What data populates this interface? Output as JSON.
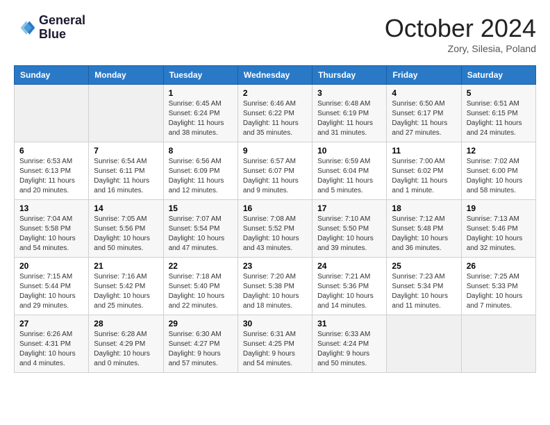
{
  "header": {
    "logo_line1": "General",
    "logo_line2": "Blue",
    "month": "October 2024",
    "location": "Zory, Silesia, Poland"
  },
  "weekdays": [
    "Sunday",
    "Monday",
    "Tuesday",
    "Wednesday",
    "Thursday",
    "Friday",
    "Saturday"
  ],
  "weeks": [
    [
      {
        "day": "",
        "sunrise": "",
        "sunset": "",
        "daylight": ""
      },
      {
        "day": "",
        "sunrise": "",
        "sunset": "",
        "daylight": ""
      },
      {
        "day": "1",
        "sunrise": "Sunrise: 6:45 AM",
        "sunset": "Sunset: 6:24 PM",
        "daylight": "Daylight: 11 hours and 38 minutes."
      },
      {
        "day": "2",
        "sunrise": "Sunrise: 6:46 AM",
        "sunset": "Sunset: 6:22 PM",
        "daylight": "Daylight: 11 hours and 35 minutes."
      },
      {
        "day": "3",
        "sunrise": "Sunrise: 6:48 AM",
        "sunset": "Sunset: 6:19 PM",
        "daylight": "Daylight: 11 hours and 31 minutes."
      },
      {
        "day": "4",
        "sunrise": "Sunrise: 6:50 AM",
        "sunset": "Sunset: 6:17 PM",
        "daylight": "Daylight: 11 hours and 27 minutes."
      },
      {
        "day": "5",
        "sunrise": "Sunrise: 6:51 AM",
        "sunset": "Sunset: 6:15 PM",
        "daylight": "Daylight: 11 hours and 24 minutes."
      }
    ],
    [
      {
        "day": "6",
        "sunrise": "Sunrise: 6:53 AM",
        "sunset": "Sunset: 6:13 PM",
        "daylight": "Daylight: 11 hours and 20 minutes."
      },
      {
        "day": "7",
        "sunrise": "Sunrise: 6:54 AM",
        "sunset": "Sunset: 6:11 PM",
        "daylight": "Daylight: 11 hours and 16 minutes."
      },
      {
        "day": "8",
        "sunrise": "Sunrise: 6:56 AM",
        "sunset": "Sunset: 6:09 PM",
        "daylight": "Daylight: 11 hours and 12 minutes."
      },
      {
        "day": "9",
        "sunrise": "Sunrise: 6:57 AM",
        "sunset": "Sunset: 6:07 PM",
        "daylight": "Daylight: 11 hours and 9 minutes."
      },
      {
        "day": "10",
        "sunrise": "Sunrise: 6:59 AM",
        "sunset": "Sunset: 6:04 PM",
        "daylight": "Daylight: 11 hours and 5 minutes."
      },
      {
        "day": "11",
        "sunrise": "Sunrise: 7:00 AM",
        "sunset": "Sunset: 6:02 PM",
        "daylight": "Daylight: 11 hours and 1 minute."
      },
      {
        "day": "12",
        "sunrise": "Sunrise: 7:02 AM",
        "sunset": "Sunset: 6:00 PM",
        "daylight": "Daylight: 10 hours and 58 minutes."
      }
    ],
    [
      {
        "day": "13",
        "sunrise": "Sunrise: 7:04 AM",
        "sunset": "Sunset: 5:58 PM",
        "daylight": "Daylight: 10 hours and 54 minutes."
      },
      {
        "day": "14",
        "sunrise": "Sunrise: 7:05 AM",
        "sunset": "Sunset: 5:56 PM",
        "daylight": "Daylight: 10 hours and 50 minutes."
      },
      {
        "day": "15",
        "sunrise": "Sunrise: 7:07 AM",
        "sunset": "Sunset: 5:54 PM",
        "daylight": "Daylight: 10 hours and 47 minutes."
      },
      {
        "day": "16",
        "sunrise": "Sunrise: 7:08 AM",
        "sunset": "Sunset: 5:52 PM",
        "daylight": "Daylight: 10 hours and 43 minutes."
      },
      {
        "day": "17",
        "sunrise": "Sunrise: 7:10 AM",
        "sunset": "Sunset: 5:50 PM",
        "daylight": "Daylight: 10 hours and 39 minutes."
      },
      {
        "day": "18",
        "sunrise": "Sunrise: 7:12 AM",
        "sunset": "Sunset: 5:48 PM",
        "daylight": "Daylight: 10 hours and 36 minutes."
      },
      {
        "day": "19",
        "sunrise": "Sunrise: 7:13 AM",
        "sunset": "Sunset: 5:46 PM",
        "daylight": "Daylight: 10 hours and 32 minutes."
      }
    ],
    [
      {
        "day": "20",
        "sunrise": "Sunrise: 7:15 AM",
        "sunset": "Sunset: 5:44 PM",
        "daylight": "Daylight: 10 hours and 29 minutes."
      },
      {
        "day": "21",
        "sunrise": "Sunrise: 7:16 AM",
        "sunset": "Sunset: 5:42 PM",
        "daylight": "Daylight: 10 hours and 25 minutes."
      },
      {
        "day": "22",
        "sunrise": "Sunrise: 7:18 AM",
        "sunset": "Sunset: 5:40 PM",
        "daylight": "Daylight: 10 hours and 22 minutes."
      },
      {
        "day": "23",
        "sunrise": "Sunrise: 7:20 AM",
        "sunset": "Sunset: 5:38 PM",
        "daylight": "Daylight: 10 hours and 18 minutes."
      },
      {
        "day": "24",
        "sunrise": "Sunrise: 7:21 AM",
        "sunset": "Sunset: 5:36 PM",
        "daylight": "Daylight: 10 hours and 14 minutes."
      },
      {
        "day": "25",
        "sunrise": "Sunrise: 7:23 AM",
        "sunset": "Sunset: 5:34 PM",
        "daylight": "Daylight: 10 hours and 11 minutes."
      },
      {
        "day": "26",
        "sunrise": "Sunrise: 7:25 AM",
        "sunset": "Sunset: 5:33 PM",
        "daylight": "Daylight: 10 hours and 7 minutes."
      }
    ],
    [
      {
        "day": "27",
        "sunrise": "Sunrise: 6:26 AM",
        "sunset": "Sunset: 4:31 PM",
        "daylight": "Daylight: 10 hours and 4 minutes."
      },
      {
        "day": "28",
        "sunrise": "Sunrise: 6:28 AM",
        "sunset": "Sunset: 4:29 PM",
        "daylight": "Daylight: 10 hours and 0 minutes."
      },
      {
        "day": "29",
        "sunrise": "Sunrise: 6:30 AM",
        "sunset": "Sunset: 4:27 PM",
        "daylight": "Daylight: 9 hours and 57 minutes."
      },
      {
        "day": "30",
        "sunrise": "Sunrise: 6:31 AM",
        "sunset": "Sunset: 4:25 PM",
        "daylight": "Daylight: 9 hours and 54 minutes."
      },
      {
        "day": "31",
        "sunrise": "Sunrise: 6:33 AM",
        "sunset": "Sunset: 4:24 PM",
        "daylight": "Daylight: 9 hours and 50 minutes."
      },
      {
        "day": "",
        "sunrise": "",
        "sunset": "",
        "daylight": ""
      },
      {
        "day": "",
        "sunrise": "",
        "sunset": "",
        "daylight": ""
      }
    ]
  ]
}
